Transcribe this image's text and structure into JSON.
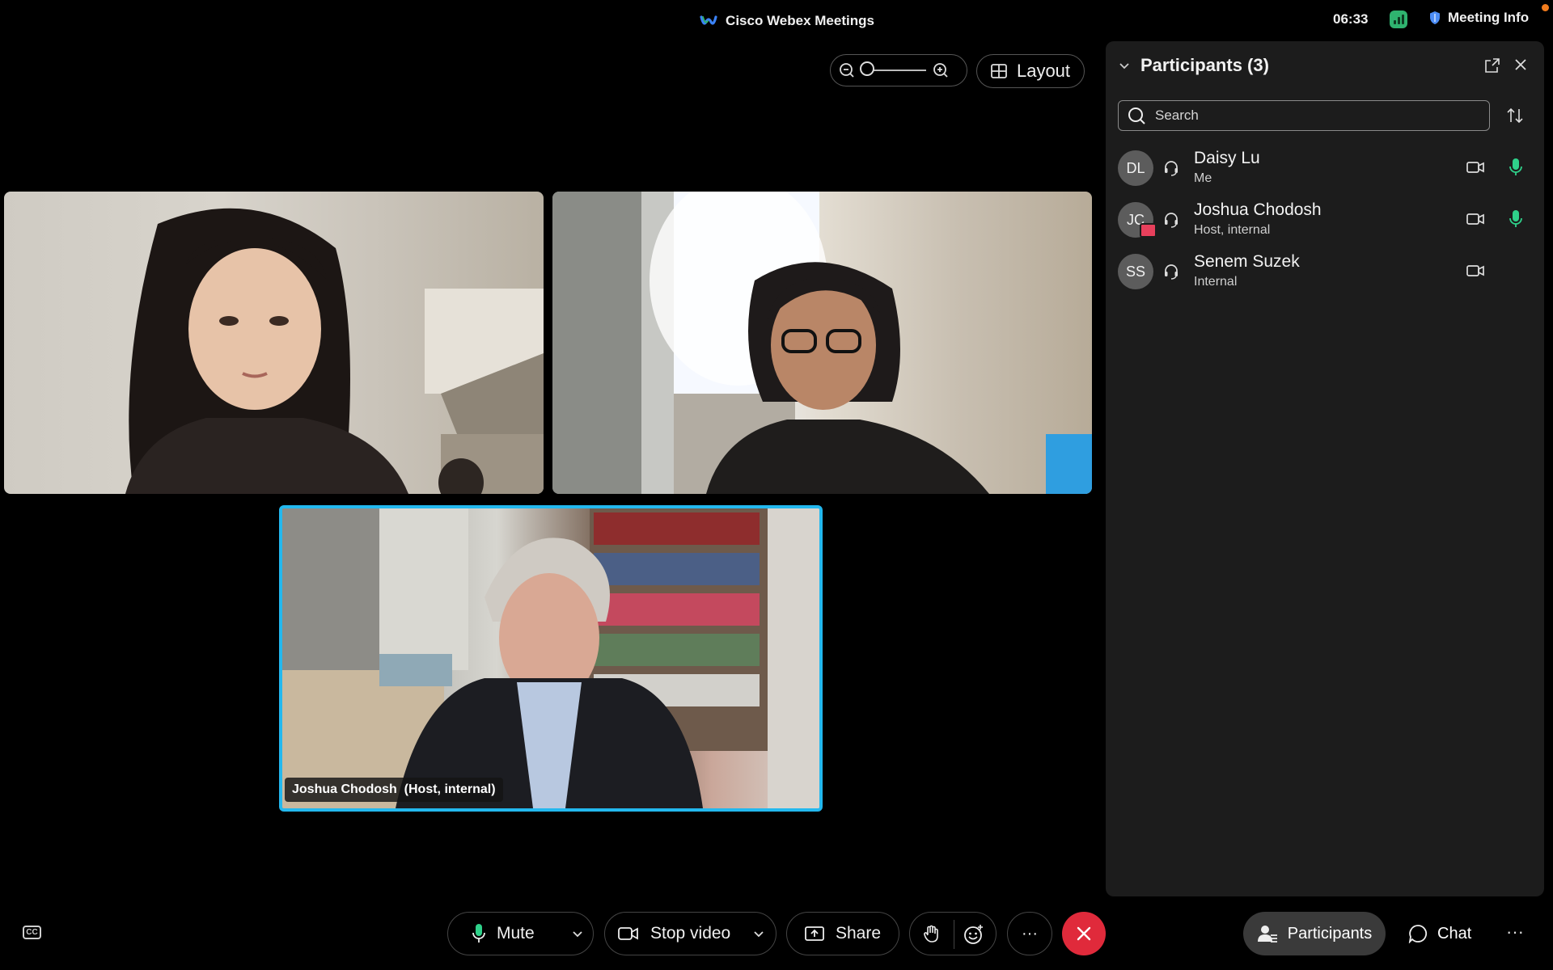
{
  "titlebar": {
    "app_title": "Cisco Webex Meetings",
    "clock": "06:33",
    "meeting_info_label": "Meeting Info",
    "brand_colors": {
      "webex_blue": "#3b82f6",
      "webex_green": "#2fb36f"
    }
  },
  "view_controls": {
    "layout_label": "Layout",
    "zoom_level": 0.0
  },
  "videos": [
    {
      "participant": "Daisy Lu"
    },
    {
      "participant": "Senem Suzek"
    },
    {
      "participant": "Joshua Chodosh",
      "name_tag": "Joshua Chodosh  (Host, internal)",
      "active_speaker": true,
      "highlight_color": "#23b8ee"
    }
  ],
  "participants_panel": {
    "title": "Participants (3)",
    "search_placeholder": "Search",
    "participants": [
      {
        "initials": "DL",
        "name": "Daisy Lu",
        "role": "Me",
        "mic": "unmuted",
        "video": true
      },
      {
        "initials": "JC",
        "name": "Joshua Chodosh",
        "role": "Host, internal",
        "mic": "unmuted",
        "video": true,
        "sharing_badge": true
      },
      {
        "initials": "SS",
        "name": "Senem Suzek",
        "role": "Internal",
        "mic": "none",
        "video": true
      }
    ]
  },
  "controls": {
    "mute_label": "Mute",
    "stop_video_label": "Stop video",
    "share_label": "Share",
    "more_label": "···",
    "participants_label": "Participants",
    "chat_label": "Chat",
    "overflow_label": "···",
    "cc_label": "CC",
    "end_color": "#e02a3b"
  }
}
